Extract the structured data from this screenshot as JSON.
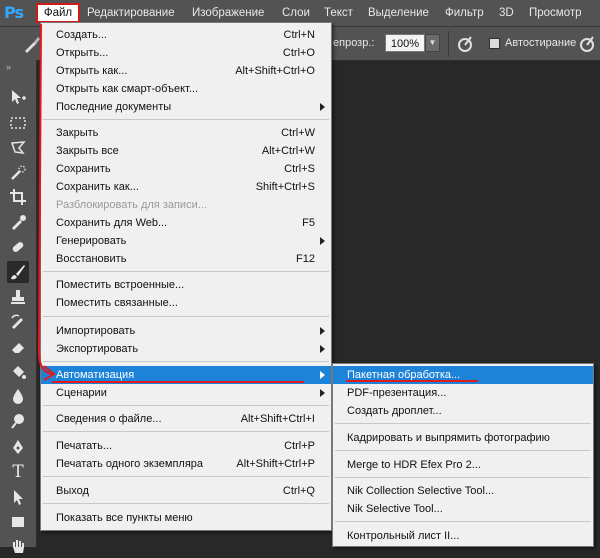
{
  "app": {
    "logo": "Ps"
  },
  "menubar": {
    "items": [
      {
        "label": "Файл",
        "active": true
      },
      {
        "label": "Редактирование"
      },
      {
        "label": "Изображение"
      },
      {
        "label": "Слои"
      },
      {
        "label": "Текст"
      },
      {
        "label": "Выделение"
      },
      {
        "label": "Фильтр"
      },
      {
        "label": "3D"
      },
      {
        "label": "Просмотр"
      }
    ]
  },
  "options_bar": {
    "opacity_label": "епрозр.:",
    "opacity_value": "100%",
    "auto_erase_label": "Автостирание"
  },
  "file_menu": {
    "items": [
      {
        "label": "Создать...",
        "shortcut": "Ctrl+N"
      },
      {
        "label": "Открыть...",
        "shortcut": "Ctrl+O"
      },
      {
        "label": "Открыть как...",
        "shortcut": "Alt+Shift+Ctrl+O"
      },
      {
        "label": "Открыть как смарт-объект..."
      },
      {
        "label": "Последние документы",
        "submenu": true
      },
      {
        "label": "Закрыть",
        "shortcut": "Ctrl+W"
      },
      {
        "label": "Закрыть все",
        "shortcut": "Alt+Ctrl+W"
      },
      {
        "label": "Сохранить",
        "shortcut": "Ctrl+S"
      },
      {
        "label": "Сохранить как...",
        "shortcut": "Shift+Ctrl+S"
      },
      {
        "label": "Разблокировать для записи...",
        "disabled": true
      },
      {
        "label": "Сохранить для Web...",
        "shortcut": "F5"
      },
      {
        "label": "Генерировать",
        "submenu": true
      },
      {
        "label": "Восстановить",
        "shortcut": "F12"
      },
      {
        "label": "Поместить встроенные..."
      },
      {
        "label": "Поместить связанные..."
      },
      {
        "label": "Импортировать",
        "submenu": true
      },
      {
        "label": "Экспортировать",
        "submenu": true
      },
      {
        "label": "Автоматизация",
        "submenu": true,
        "highlighted": true
      },
      {
        "label": "Сценарии",
        "submenu": true
      },
      {
        "label": "Сведения о файле...",
        "shortcut": "Alt+Shift+Ctrl+I"
      },
      {
        "label": "Печатать...",
        "shortcut": "Ctrl+P"
      },
      {
        "label": "Печатать одного экземпляра",
        "shortcut": "Alt+Shift+Ctrl+P"
      },
      {
        "label": "Выход",
        "shortcut": "Ctrl+Q"
      },
      {
        "label": "Показать все пункты меню"
      }
    ]
  },
  "automation_menu": {
    "items": [
      {
        "label": "Пакетная обработка...",
        "highlighted": true
      },
      {
        "label": "PDF-презентация..."
      },
      {
        "label": "Создать дроплет..."
      },
      {
        "label": "Кадрировать и выпрямить фотографию"
      },
      {
        "label": "Merge to HDR Efex Pro 2..."
      },
      {
        "label": "Nik Collection Selective Tool..."
      },
      {
        "label": "Nik Selective Tool..."
      },
      {
        "label": "Контрольный лист II..."
      }
    ]
  },
  "colors": {
    "menu_highlight": "#1d83d8",
    "annotation_red": "#e01b1b",
    "chrome": "#535353"
  }
}
